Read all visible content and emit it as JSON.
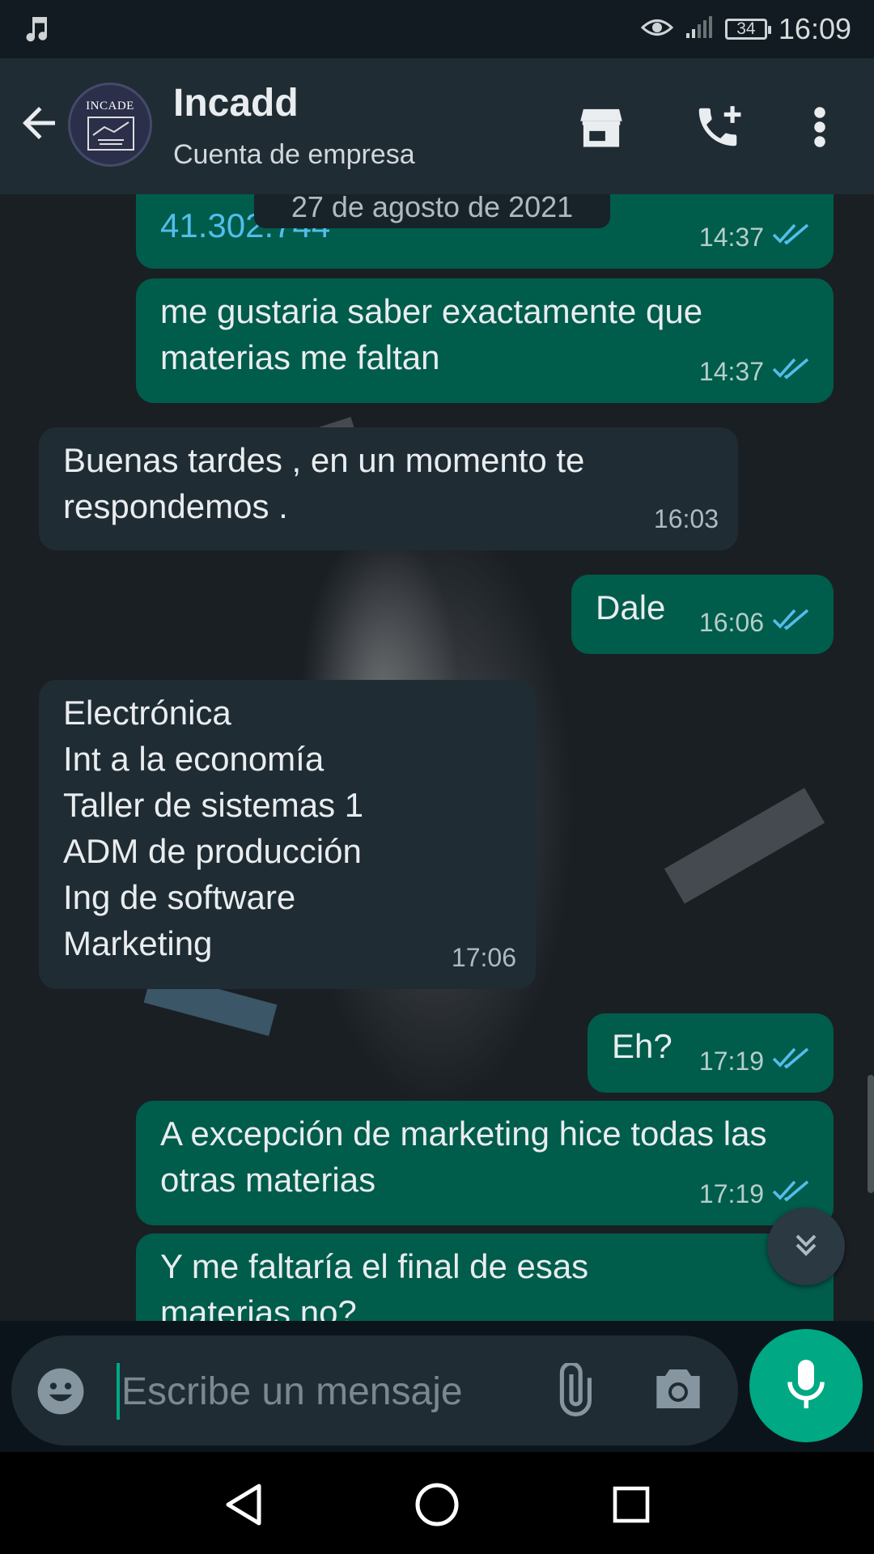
{
  "status_bar": {
    "time": "16:09",
    "battery": "34"
  },
  "header": {
    "title": "Incadd",
    "subtitle": "Cuenta de empresa",
    "avatar_text": "INCADE"
  },
  "chat": {
    "date_chip": "27 de agosto de 2021",
    "messages": [
      {
        "dir": "out",
        "text": "41.302.744",
        "time": "14:37",
        "status": "read"
      },
      {
        "dir": "out",
        "text": "me gustaria saber exactamente que materias me faltan",
        "time": "14:37",
        "status": "read"
      },
      {
        "dir": "in",
        "text": "Buenas tardes , en un momento te respondemos .",
        "time": "16:03"
      },
      {
        "dir": "out",
        "text": "Dale",
        "time": "16:06",
        "status": "read"
      },
      {
        "dir": "in",
        "text": "Electrónica\nInt a la economía\nTaller de sistemas 1\nADM de producción\nIng de software\nMarketing",
        "time": "17:06"
      },
      {
        "dir": "out",
        "text": "Eh?",
        "time": "17:19",
        "status": "read"
      },
      {
        "dir": "out",
        "text": "A excepción de marketing hice todas las otras materias",
        "time": "17:19",
        "status": "read"
      },
      {
        "dir": "out",
        "text": "Y me faltaría el final de esas materias no?",
        "time": "",
        "status": "read"
      }
    ]
  },
  "input": {
    "placeholder": "Escribe un mensaje"
  },
  "colors": {
    "outgoing": "#005c4b",
    "incoming": "#202c33",
    "accent": "#00a884",
    "read_ticks": "#53bdeb"
  },
  "icons": [
    "music-note-icon",
    "eye-icon",
    "signal-icon",
    "battery-icon",
    "back-arrow-icon",
    "store-icon",
    "call-add-icon",
    "more-vert-icon",
    "double-check-icon",
    "scroll-down-icon",
    "emoji-icon",
    "attach-icon",
    "camera-icon",
    "mic-icon",
    "nav-back-icon",
    "nav-home-icon",
    "nav-recents-icon"
  ]
}
